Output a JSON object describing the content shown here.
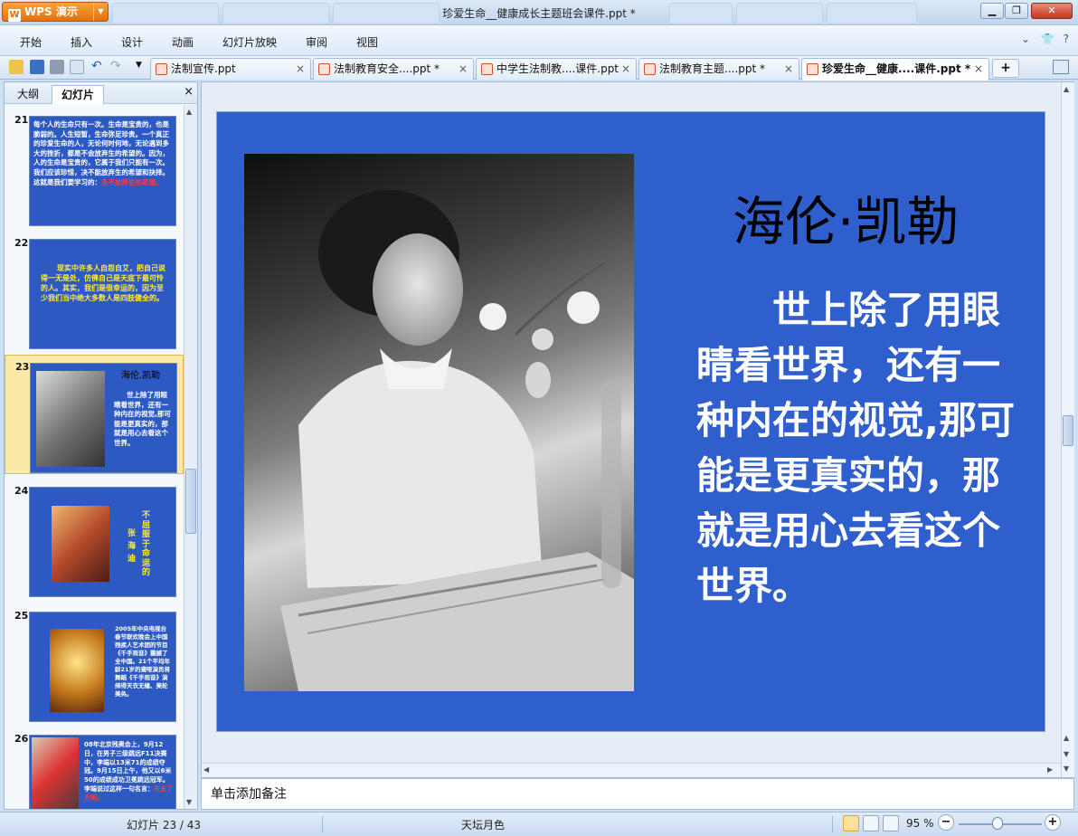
{
  "app": {
    "name": "WPS 演示",
    "window_title": "珍爱生命__健康成长主题班会课件.ppt *"
  },
  "menu": [
    "开始",
    "插入",
    "设计",
    "动画",
    "幻灯片放映",
    "审阅",
    "视图"
  ],
  "doc_tabs": [
    {
      "label": "法制宣传.ppt",
      "active": false
    },
    {
      "label": "法制教育安全....ppt *",
      "active": false
    },
    {
      "label": "中学生法制教....课件.ppt",
      "active": false
    },
    {
      "label": "法制教育主题....ppt *",
      "active": false
    },
    {
      "label": "珍爱生命__健康....课件.ppt *",
      "active": true
    }
  ],
  "new_tab_label": "+",
  "left_panel": {
    "tabs": [
      "大纲",
      "幻灯片"
    ],
    "active_tab": "幻灯片",
    "close_label": "×",
    "thumbnails": [
      {
        "num": "21",
        "text": "每个人的生命只有一次。生命是宝贵的，也是脆弱的。人生短暂，生命弥足珍贵。一个真正的珍爱生命的人，无论何时何地，无论遇到多大的挫折，都是不会放弃生的希望的。因为，人的生命是宝贵的，它属于我们只能有一次。我们应该珍惜，决不能放弃生的希望和抉择。这就是我们要学习的：",
        "highlight": "永不放弃生的希望。"
      },
      {
        "num": "22",
        "text": "现实中许多人自怨自艾，把自己说得一无是处，仿佛自己是天底下最可怜的人。其实，我们是很幸运的，因为至少我们当中绝大多数人是四肢健全的。"
      },
      {
        "num": "23",
        "title": "海伦.凯勒",
        "text": "世上除了用眼睛看世界，还有一种内在的视觉,那可能是更真实的，那就是用心去看这个世界。",
        "selected": true
      },
      {
        "num": "24",
        "text": "不屈服于命运的",
        "name": "张海迪"
      },
      {
        "num": "25",
        "text": "2005年中央电视台春节联欢晚会上中国残疾人艺术团的节目《千手观音》震撼了全中国。21个平均年龄21岁的聋哑演员将舞蹈《千手观音》演绎得天衣无缝、美轮美奂。"
      },
      {
        "num": "26",
        "text": "08年北京残奥会上，9月12日，在男子三级跳远F11决赛中，李端以13米71的成绩夺冠。9月15日上午，他又以6米50的成绩成功卫冕跳远冠军。李端说过这样一句名言：",
        "highlight": "失去了光明，"
      }
    ]
  },
  "slide": {
    "title": "海伦·凯勒",
    "body": "世上除了用眼睛看世界，还有一种内在的视觉,那可能是更真实的，那就是用心去看这个世界。",
    "background_color": "#2f5fcc",
    "photo": "helen-keller-portrait"
  },
  "notes_placeholder": "单击添加备注",
  "status": {
    "slide_counter": "幻灯片 23 / 43",
    "theme": "天坛月色",
    "zoom": "95 %"
  }
}
